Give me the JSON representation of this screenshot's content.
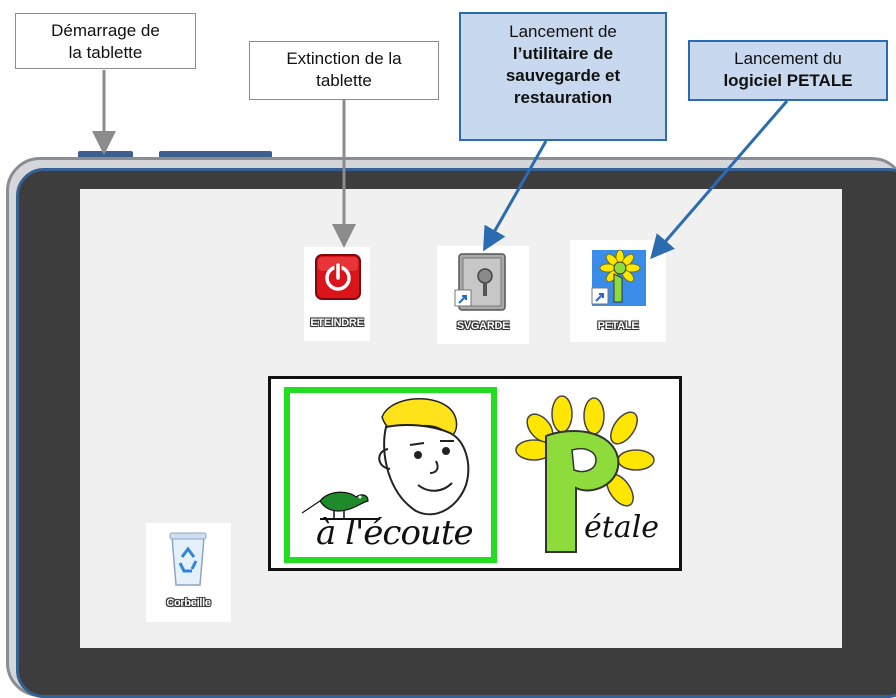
{
  "callouts": {
    "startup": {
      "line1": "Démarrage de",
      "line2": "la tablette"
    },
    "shutdown": {
      "line1": "Extinction de la",
      "line2": "tablette"
    },
    "backup": {
      "line1": "Lancement de",
      "line2": "l’utilitaire de",
      "line3": "sauvegarde et",
      "line4": "restauration"
    },
    "petale": {
      "line1": "Lancement du",
      "line2": "logiciel PETALE"
    }
  },
  "desktop": {
    "icons": [
      {
        "label": "ETEINDRE",
        "icon": "power-icon",
        "color": "#d9141b"
      },
      {
        "label": "SVGARDE",
        "icon": "safe-icon",
        "color": "#9b9b9b"
      },
      {
        "label": "PETALE",
        "icon": "petale-icon",
        "color": "#3a8ce8"
      },
      {
        "label": "Corbeille",
        "icon": "recycle-bin-icon",
        "color": "#5aa0d8"
      }
    ],
    "logos": {
      "ecoute": {
        "text": "à l'écoute",
        "border_color": "#22dd22"
      },
      "petale": {
        "text": "étale",
        "petal_color": "#ffe600",
        "stem_color": "#8ddc3c"
      }
    }
  },
  "colors": {
    "accent_blue": "#2b6cb0",
    "callout_blue_fill": "#c8d8ee",
    "bezel": "#3d3d3d",
    "screen": "#f0f0f0"
  }
}
